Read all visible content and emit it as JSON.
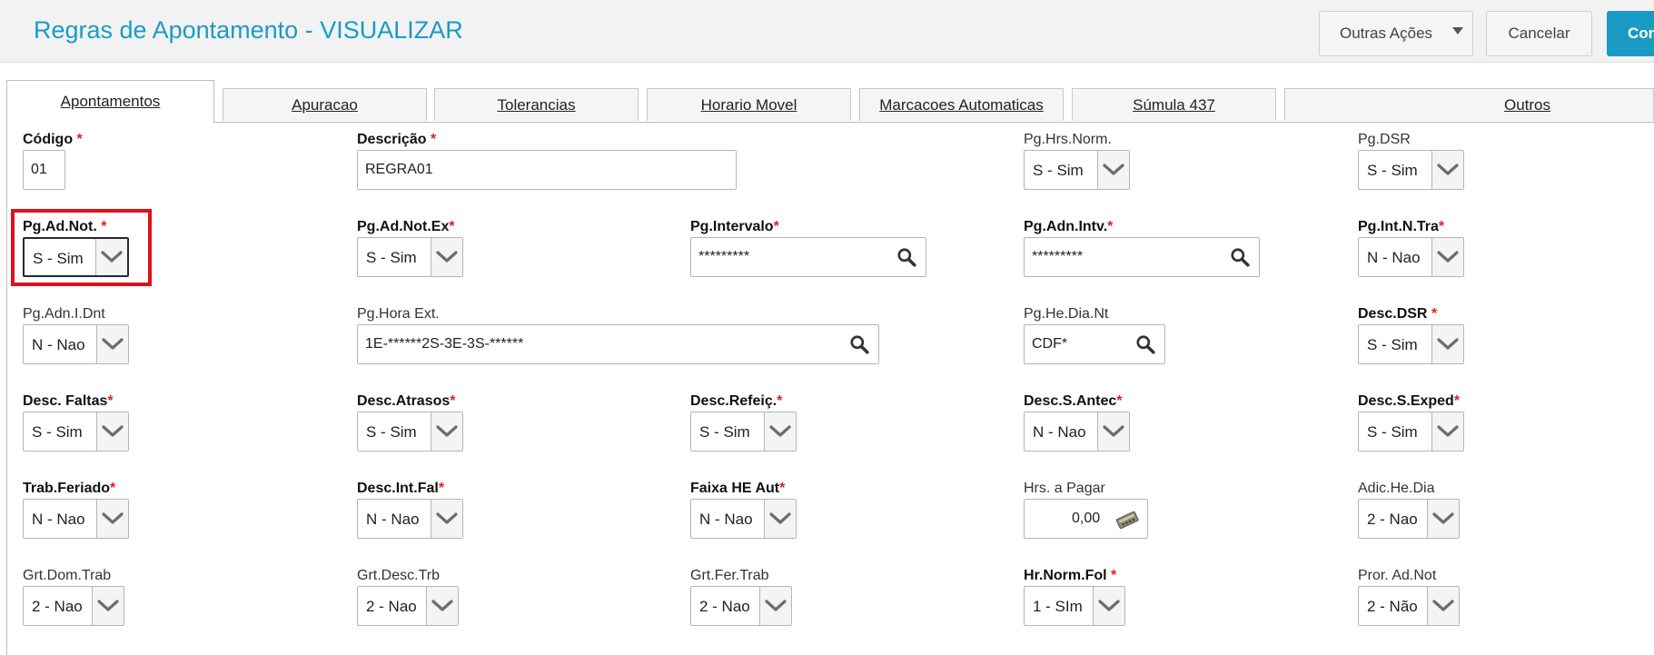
{
  "header": {
    "title": "Regras de Apontamento - VISUALIZAR",
    "outras_acoes": "Outras Ações",
    "cancelar": "Cancelar",
    "confirmar": "Con"
  },
  "tabs": [
    {
      "label": "Apontamentos"
    },
    {
      "label": "Apuracao"
    },
    {
      "label": "Tolerancias"
    },
    {
      "label": "Horario Movel"
    },
    {
      "label": "Marcacoes Automaticas"
    },
    {
      "label": "Súmula 437"
    },
    {
      "label": "Outros"
    }
  ],
  "form": {
    "codigo": {
      "label": "Código",
      "value": "01"
    },
    "descricao": {
      "label": "Descrição",
      "value": "REGRA01"
    },
    "pg_hrs_norm": {
      "label": "Pg.Hrs.Norm.",
      "value": "S - Sim"
    },
    "pg_dsr": {
      "label": "Pg.DSR",
      "value": "S - Sim"
    },
    "pg_ad_not": {
      "label": "Pg.Ad.Not.",
      "value": "S - Sim"
    },
    "pg_ad_not_ex": {
      "label": "Pg.Ad.Not.Ex",
      "value": "S - Sim"
    },
    "pg_intervalo": {
      "label": "Pg.Intervalo",
      "value": "*********"
    },
    "pg_adn_intv": {
      "label": "Pg.Adn.Intv.",
      "value": "*********"
    },
    "pg_int_n_tra": {
      "label": "Pg.Int.N.Tra",
      "value": "N - Nao"
    },
    "pg_adn_i_dnt": {
      "label": "Pg.Adn.I.Dnt",
      "value": "N - Nao"
    },
    "pg_hora_ext": {
      "label": "Pg.Hora Ext.",
      "value": "1E-******2S-3E-3S-******"
    },
    "pg_he_dia_nt": {
      "label": "Pg.He.Dia.Nt",
      "value": "CDF*"
    },
    "desc_dsr": {
      "label": "Desc.DSR",
      "value": "S - Sim"
    },
    "desc_faltas": {
      "label": "Desc. Faltas",
      "value": "S - Sim"
    },
    "desc_atrasos": {
      "label": "Desc.Atrasos",
      "value": "S - Sim"
    },
    "desc_refeic": {
      "label": "Desc.Refeiç.",
      "value": "S - Sim"
    },
    "desc_s_antec": {
      "label": "Desc.S.Antec",
      "value": "N - Nao"
    },
    "desc_s_exped": {
      "label": "Desc.S.Exped",
      "value": "S - Sim"
    },
    "trab_feriado": {
      "label": "Trab.Feriado",
      "value": "N - Nao"
    },
    "desc_int_fal": {
      "label": "Desc.Int.Fal",
      "value": "N - Nao"
    },
    "faixa_he_aut": {
      "label": "Faixa HE Aut",
      "value": "N - Nao"
    },
    "hrs_a_pagar": {
      "label": "Hrs. a Pagar",
      "value": "0,00"
    },
    "adic_he_dia": {
      "label": "Adic.He.Dia",
      "value": "2 - Nao"
    },
    "grt_dom_trab": {
      "label": "Grt.Dom.Trab",
      "value": "2 - Nao"
    },
    "grt_desc_trb": {
      "label": "Grt.Desc.Trb",
      "value": "2 - Nao"
    },
    "grt_fer_trab": {
      "label": "Grt.Fer.Trab",
      "value": "2 - Nao"
    },
    "hr_norm_fol": {
      "label": "Hr.Norm.Fol",
      "value": "1 - SIm"
    },
    "pror_ad_not": {
      "label": "Pror. Ad.Not",
      "value": "2 - Não"
    }
  },
  "required_marker": "*",
  "colors": {
    "accent": "#1a9bc6",
    "required": "#e02020",
    "highlight": "#e0101a"
  }
}
